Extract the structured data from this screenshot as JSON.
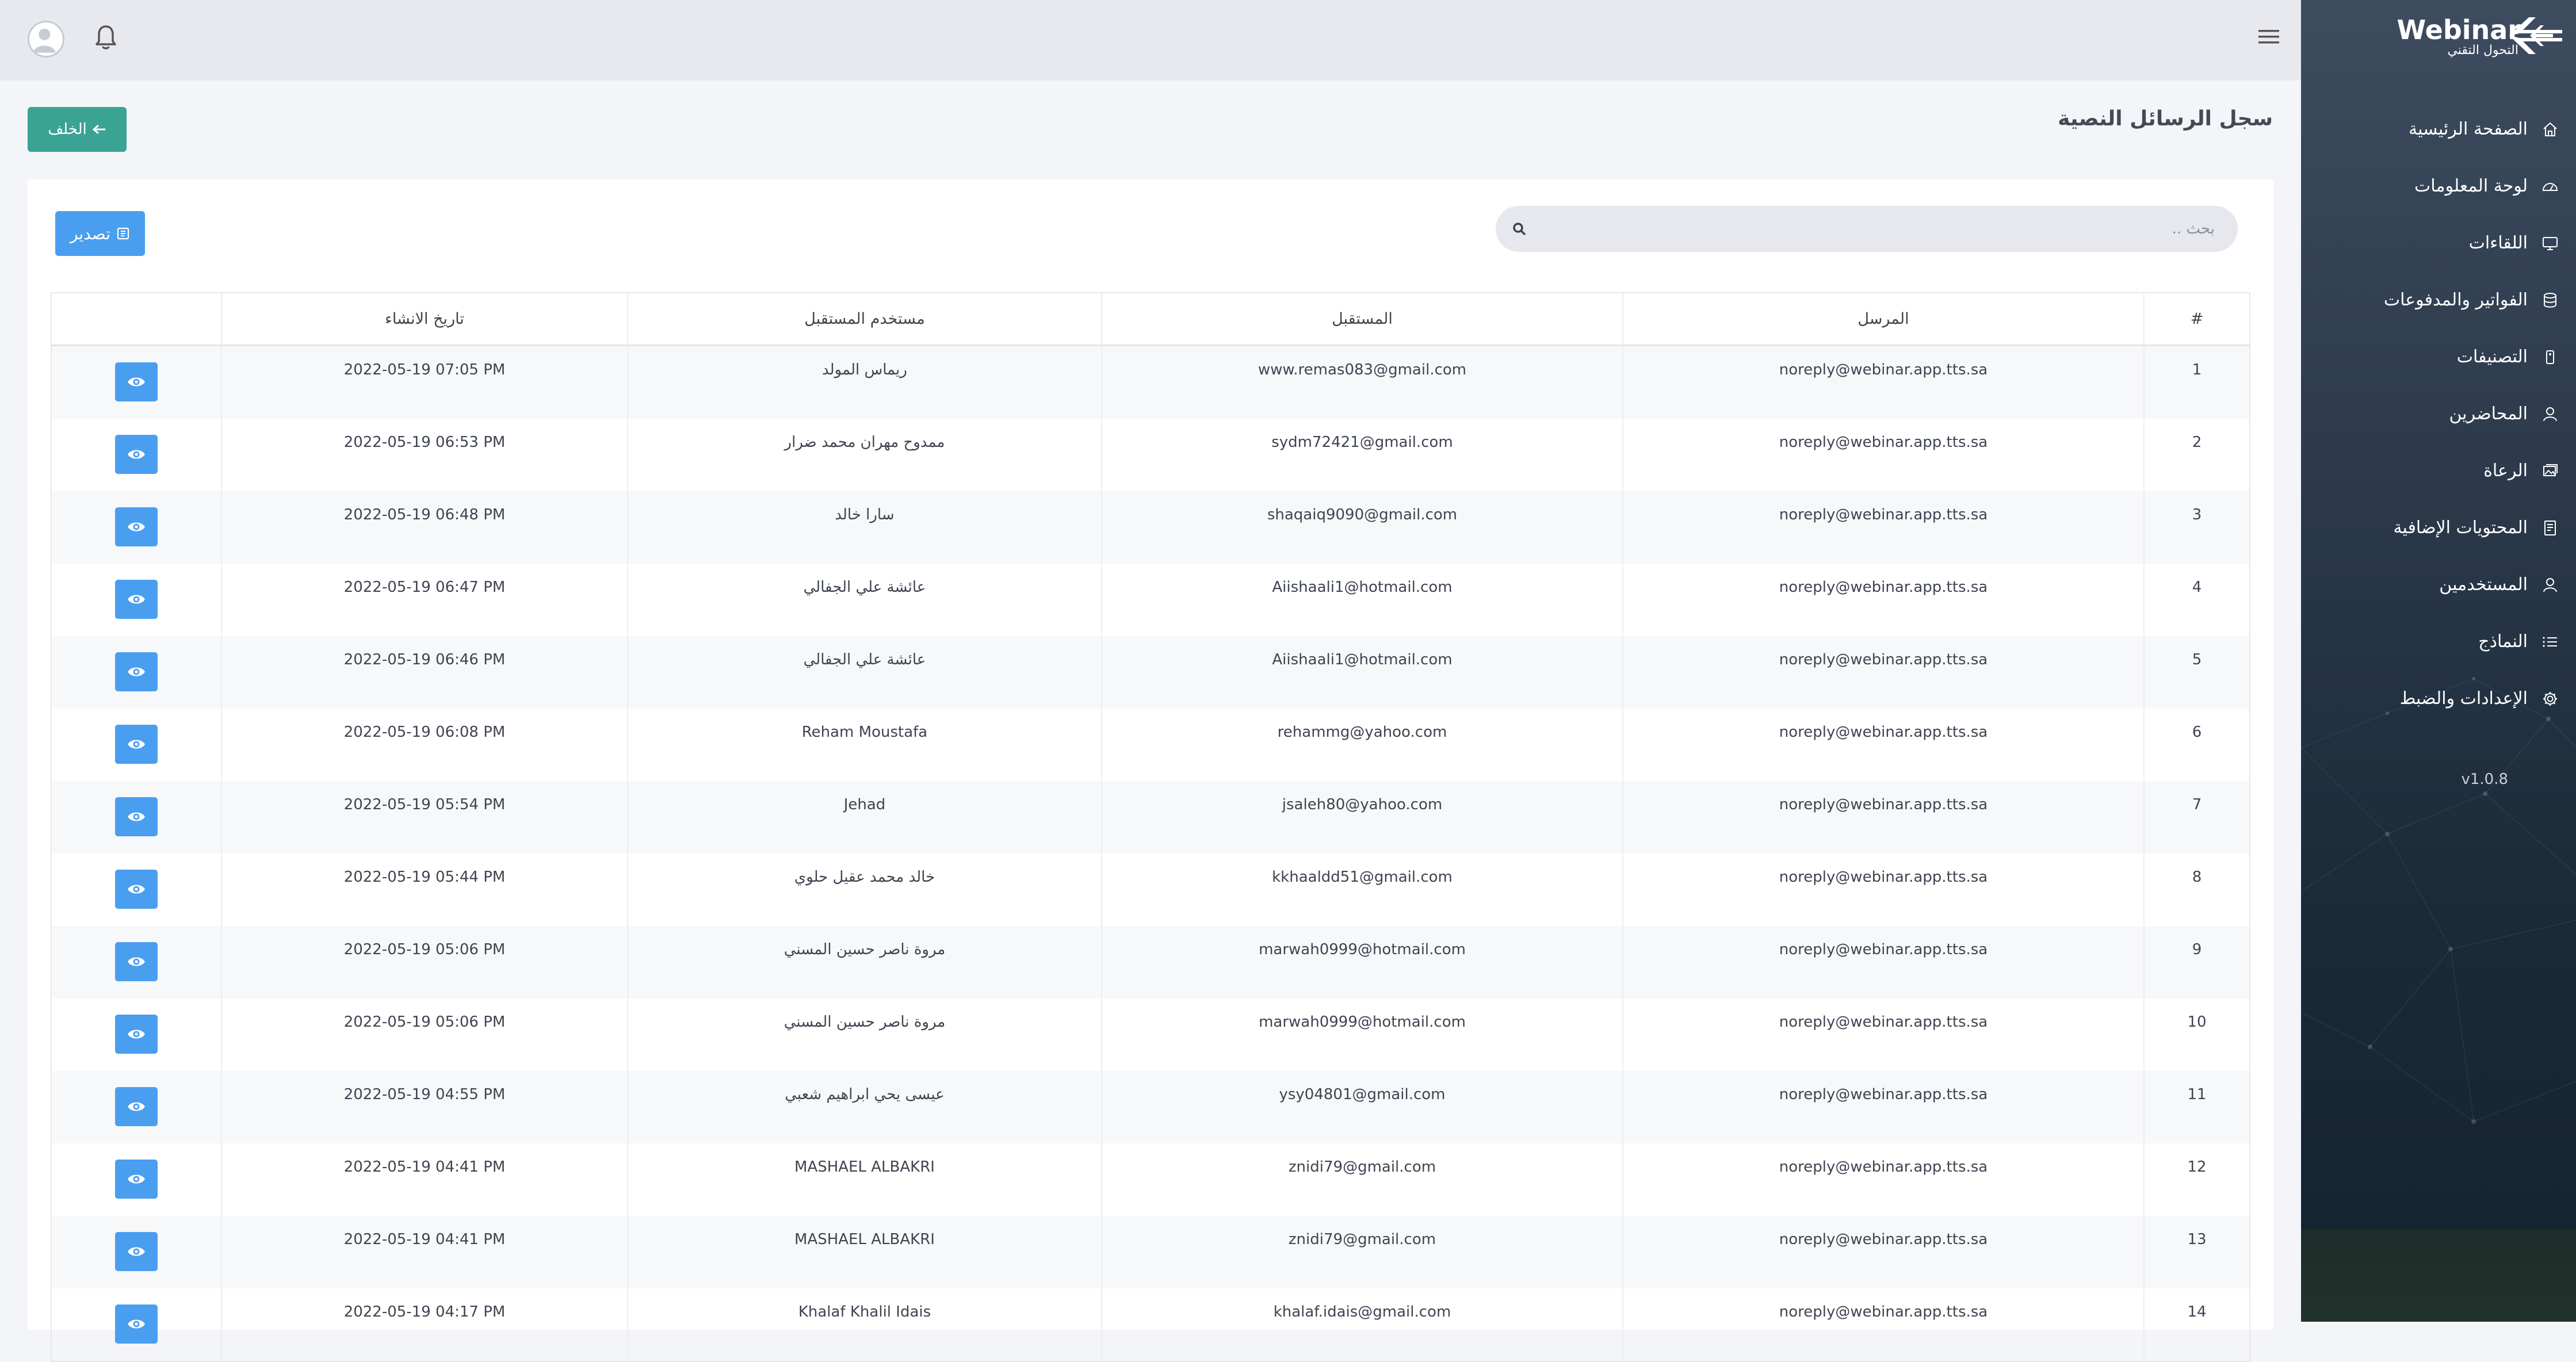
{
  "brand": {
    "name": "Webinar",
    "subtitle": "التحول التقني"
  },
  "sidebar": {
    "items": [
      {
        "label": "الصفحة الرئيسية",
        "icon": "home-icon"
      },
      {
        "label": "لوحة المعلومات",
        "icon": "dashboard-icon"
      },
      {
        "label": "اللقاءات",
        "icon": "monitor-icon"
      },
      {
        "label": "الفواتير والمدفوعات",
        "icon": "database-icon"
      },
      {
        "label": "التصنيفات",
        "icon": "tag-icon"
      },
      {
        "label": "المحاضرين",
        "icon": "user-icon"
      },
      {
        "label": "الرعاة",
        "icon": "images-icon"
      },
      {
        "label": "المحتويات الإضافية",
        "icon": "document-icon"
      },
      {
        "label": "المستخدمين",
        "icon": "user-icon"
      },
      {
        "label": "النماذج",
        "icon": "list-icon"
      },
      {
        "label": "الإعدادات والضبط",
        "icon": "gear-icon"
      }
    ],
    "version": "v1.0.8"
  },
  "header": {
    "title": "سجل الرسائل النصية",
    "back_label": "الخلف"
  },
  "toolbar": {
    "export_label": "تصدير",
    "search_placeholder": "بحث .."
  },
  "table": {
    "columns": [
      "#",
      "المرسل",
      "المستقبل",
      "مستخدم المستقبل",
      "تاريخ الانشاء",
      ""
    ],
    "rows": [
      {
        "num": "1",
        "sender": "noreply@webinar.app.tts.sa",
        "receiver": "www.remas083@gmail.com",
        "user": "ريماس المولد",
        "date": "2022-05-19 07:05 PM"
      },
      {
        "num": "2",
        "sender": "noreply@webinar.app.tts.sa",
        "receiver": "sydm72421@gmail.com",
        "user": "ممدوح مهران محمد ضرار",
        "date": "2022-05-19 06:53 PM"
      },
      {
        "num": "3",
        "sender": "noreply@webinar.app.tts.sa",
        "receiver": "shaqaiq9090@gmail.com",
        "user": "سارا خالد",
        "date": "2022-05-19 06:48 PM"
      },
      {
        "num": "4",
        "sender": "noreply@webinar.app.tts.sa",
        "receiver": "Aiishaali1@hotmail.com",
        "user": "عائشة علي الجفالي",
        "date": "2022-05-19 06:47 PM"
      },
      {
        "num": "5",
        "sender": "noreply@webinar.app.tts.sa",
        "receiver": "Aiishaali1@hotmail.com",
        "user": "عائشة علي الجفالي",
        "date": "2022-05-19 06:46 PM"
      },
      {
        "num": "6",
        "sender": "noreply@webinar.app.tts.sa",
        "receiver": "rehammg@yahoo.com",
        "user": "Reham Moustafa",
        "date": "2022-05-19 06:08 PM"
      },
      {
        "num": "7",
        "sender": "noreply@webinar.app.tts.sa",
        "receiver": "jsaleh80@yahoo.com",
        "user": "Jehad",
        "date": "2022-05-19 05:54 PM"
      },
      {
        "num": "8",
        "sender": "noreply@webinar.app.tts.sa",
        "receiver": "kkhaaldd51@gmail.com",
        "user": "خالد محمد عقيل حلوي",
        "date": "2022-05-19 05:44 PM"
      },
      {
        "num": "9",
        "sender": "noreply@webinar.app.tts.sa",
        "receiver": "marwah0999@hotmail.com",
        "user": "مروة ناصر حسين المسني",
        "date": "2022-05-19 05:06 PM"
      },
      {
        "num": "10",
        "sender": "noreply@webinar.app.tts.sa",
        "receiver": "marwah0999@hotmail.com",
        "user": "مروة ناصر حسين المسني",
        "date": "2022-05-19 05:06 PM"
      },
      {
        "num": "11",
        "sender": "noreply@webinar.app.tts.sa",
        "receiver": "ysy04801@gmail.com",
        "user": "عيسى يحي ابراهيم شعبي",
        "date": "2022-05-19 04:55 PM"
      },
      {
        "num": "12",
        "sender": "noreply@webinar.app.tts.sa",
        "receiver": "znidi79@gmail.com",
        "user": "MASHAEL ALBAKRI",
        "date": "2022-05-19 04:41 PM"
      },
      {
        "num": "13",
        "sender": "noreply@webinar.app.tts.sa",
        "receiver": "znidi79@gmail.com",
        "user": "MASHAEL ALBAKRI",
        "date": "2022-05-19 04:41 PM"
      },
      {
        "num": "14",
        "sender": "noreply@webinar.app.tts.sa",
        "receiver": "khalaf.idais@gmail.com",
        "user": "Khalaf Khalil Idais",
        "date": "2022-05-19 04:17 PM"
      }
    ]
  },
  "colors": {
    "accent_teal": "#3aa394",
    "accent_blue": "#4a9ef0",
    "sidebar_dark": "#2c3a4c"
  }
}
